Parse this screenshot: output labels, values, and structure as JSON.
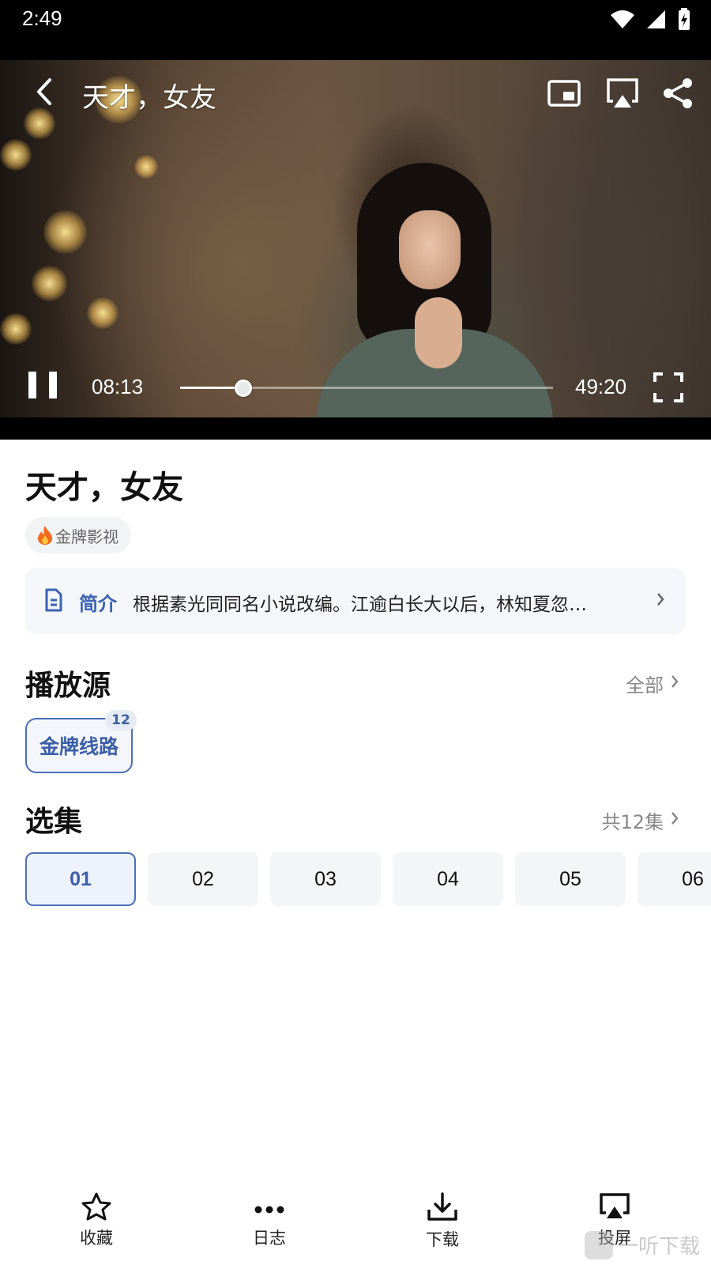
{
  "status_bar": {
    "time": "2:49"
  },
  "player": {
    "title": "天才，女友",
    "current_time": "08:13",
    "total_time": "49:20",
    "progress_fraction": 0.17
  },
  "detail": {
    "title": "天才，女友",
    "source_tag": "金牌影视",
    "intro_label": "简介",
    "intro_text": "根据素光同同名小说改编。江逾白长大以后，林知夏忽…"
  },
  "play_source": {
    "heading": "播放源",
    "more_label": "全部",
    "line_label": "金牌线路",
    "line_count": "12"
  },
  "episodes": {
    "heading": "选集",
    "total_label": "共12集",
    "items": [
      "01",
      "02",
      "03",
      "04",
      "05",
      "06"
    ]
  },
  "bottom_bar": {
    "favorite": "收藏",
    "log": "日志",
    "download": "下载",
    "cast": "投屏"
  },
  "watermark": "一听下载",
  "colors": {
    "accent": "#3b5fa8",
    "accent_border": "#4b6fb8",
    "intro_bg": "#f4f6fa"
  }
}
